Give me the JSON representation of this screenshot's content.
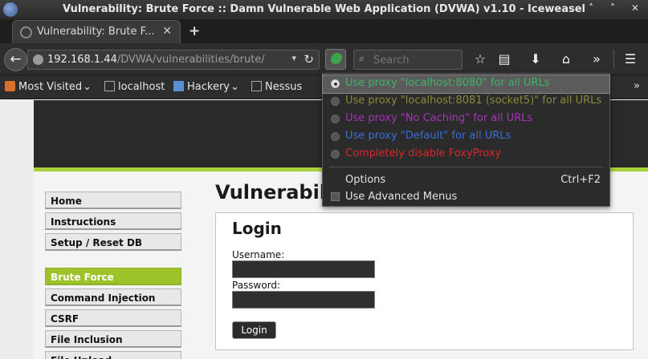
{
  "window": {
    "title": "Vulnerability: Brute Force :: Damn Vulnerable Web Application (DVWA) v1.10 - Iceweasel"
  },
  "tab": {
    "label": "Vulnerability: Brute F...",
    "new_tab": "+"
  },
  "nav": {
    "url_host": "192.168.1.44",
    "url_path": "/DVWA/vulnerabilities/brute/",
    "search_placeholder": "Search"
  },
  "bookmarks": [
    {
      "label": "Most Visited",
      "dropdown": true,
      "icon": "most-visited-icon"
    },
    {
      "label": "localhost",
      "dropdown": false,
      "icon": "page-icon"
    },
    {
      "label": "Hackery",
      "dropdown": true,
      "icon": "folder-icon"
    },
    {
      "label": "Nessus",
      "dropdown": false,
      "icon": "page-icon"
    }
  ],
  "sidebar": {
    "items": [
      {
        "label": "Home"
      },
      {
        "label": "Instructions"
      },
      {
        "label": "Setup / Reset DB"
      },
      {
        "label": "Brute Force",
        "active": true
      },
      {
        "label": "Command Injection"
      },
      {
        "label": "CSRF"
      },
      {
        "label": "File Inclusion"
      },
      {
        "label": "File Upload"
      }
    ]
  },
  "main": {
    "page_title": "Vulnerability: Brute Force",
    "login_title": "Login",
    "username_label": "Username:",
    "password_label": "Password:",
    "username_value": "",
    "password_value": "",
    "login_button": "Login"
  },
  "foxyproxy": {
    "items": [
      {
        "label": "Use proxy \"localhost:8080\" for all URLs",
        "color": "#3fb36a",
        "selected": true
      },
      {
        "label": "Use proxy \"localhost:8081 (socket5)\" for all URLs",
        "color": "#8a8a3a",
        "selected": false
      },
      {
        "label": "Use proxy \"No Caching\" for all URLs",
        "color": "#a633b8",
        "selected": false
      },
      {
        "label": "Use proxy \"Default\" for all URLs",
        "color": "#3a6fd8",
        "selected": false
      },
      {
        "label": "Completely disable FoxyProxy",
        "color": "#d42a2a",
        "selected": false
      }
    ],
    "options_label": "Options",
    "options_shortcut": "Ctrl+F2",
    "advanced_label": "Use Advanced Menus",
    "advanced_checked": false
  },
  "colors": {
    "accent_green": "#a9d13b",
    "active_menu": "#9ec32a"
  }
}
